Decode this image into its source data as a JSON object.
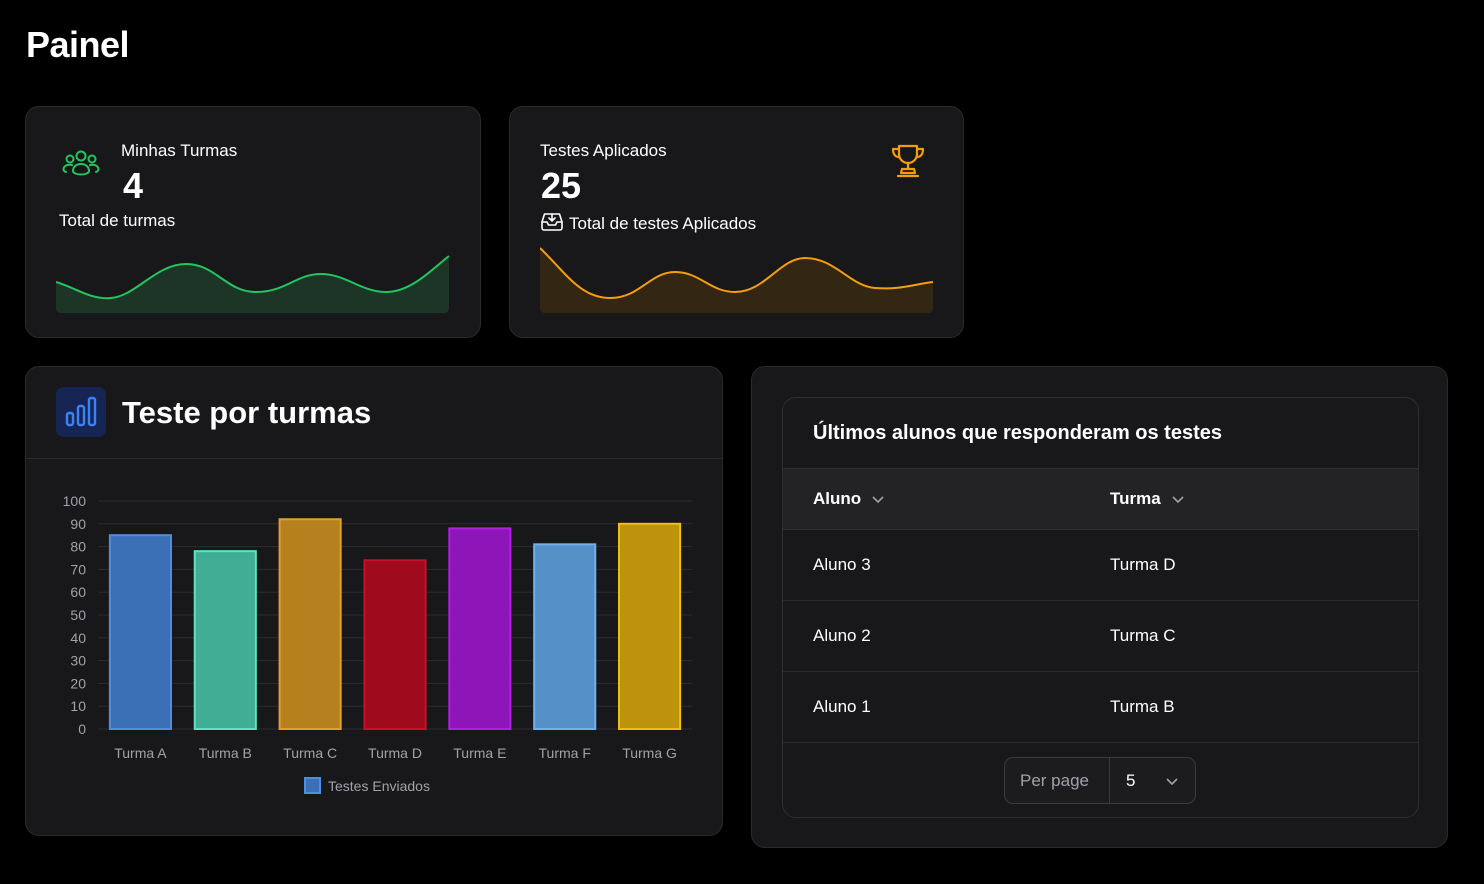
{
  "page": {
    "title": "Painel"
  },
  "stats": [
    {
      "title": "Minhas Turmas",
      "value": "4",
      "subtitle": "Total de turmas",
      "icon": "users-icon",
      "color": "#22c55e"
    },
    {
      "title": "Testes Aplicados",
      "value": "25",
      "subtitle": "Total de testes Aplicados",
      "icon": "trophy-icon",
      "subicon": "inbox-download-icon",
      "color": "#f59e0b"
    }
  ],
  "chart_card": {
    "title": "Teste por turmas",
    "icon": "bar-chart-icon"
  },
  "chart_data": {
    "type": "bar",
    "categories": [
      "Turma A",
      "Turma B",
      "Turma C",
      "Turma D",
      "Turma E",
      "Turma F",
      "Turma G"
    ],
    "series": [
      {
        "name": "Testes Enviados",
        "values": [
          85,
          78,
          92,
          74,
          88,
          81,
          90
        ]
      }
    ],
    "bar_colors": [
      "#3b6fb6",
      "#3fae94",
      "#b7801f",
      "#a00a1d",
      "#8e16b8",
      "#5590c6",
      "#bd920d"
    ],
    "bar_border_colors": [
      "#4f8fe0",
      "#5ee2c0",
      "#e0a030",
      "#c8102a",
      "#b020e0",
      "#70b0ee",
      "#f0c010"
    ],
    "legend_color": "#3b6fb6",
    "ylim": [
      0,
      100
    ],
    "yticks": [
      0,
      10,
      20,
      30,
      40,
      50,
      60,
      70,
      80,
      90,
      100
    ],
    "legend": "bottom",
    "grid": true
  },
  "table": {
    "heading": "Últimos alunos que responderam os testes",
    "columns": [
      "Aluno",
      "Turma"
    ],
    "rows": [
      [
        "Aluno 3",
        "Turma D"
      ],
      [
        "Aluno 2",
        "Turma C"
      ],
      [
        "Aluno 1",
        "Turma B"
      ]
    ],
    "pager": {
      "label": "Per page",
      "value": "5"
    }
  }
}
